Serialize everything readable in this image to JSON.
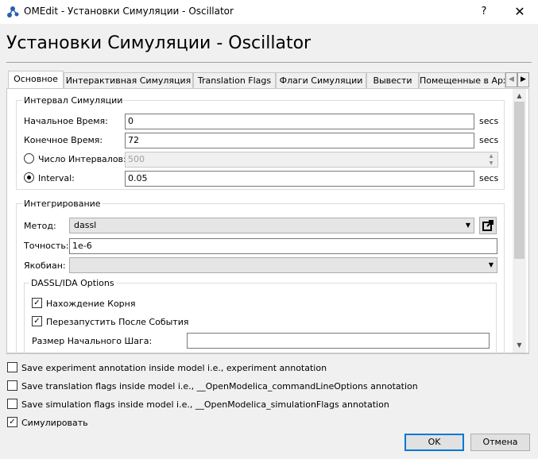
{
  "window": {
    "title": "OMEdit - Установки Симуляции - Oscillator",
    "help_label": "?",
    "close_label": "✕"
  },
  "heading": "Установки Симуляции - Oscillator",
  "tabs": [
    {
      "label": "Основное",
      "active": true
    },
    {
      "label": "Интерактивная Симуляция",
      "active": false
    },
    {
      "label": "Translation Flags",
      "active": false
    },
    {
      "label": "Флаги Симуляции",
      "active": false
    },
    {
      "label": "Вывести",
      "active": false
    },
    {
      "label": "Помещенные в Арх",
      "active": false
    }
  ],
  "interval": {
    "title": "Интервал Симуляции",
    "start_label": "Начальное Время:",
    "start_value": "0",
    "start_unit": "secs",
    "stop_label": "Конечное Время:",
    "stop_value": "72",
    "stop_unit": "secs",
    "intervals_label": "Число Интервалов:",
    "intervals_value": "500",
    "intervals_selected": false,
    "interval_label": "Interval:",
    "interval_value": "0.05",
    "interval_unit": "secs",
    "interval_selected": true
  },
  "integration": {
    "title": "Интегрирование",
    "method_label": "Метод:",
    "method_value": "dassl",
    "tolerance_label": "Точность:",
    "tolerance_value": "1e-6",
    "jacobian_label": "Якобиан:",
    "jacobian_value": "",
    "dassl": {
      "title": "DASSL/IDA Options",
      "root_finding_label": "Нахождение Корня",
      "root_finding_checked": true,
      "restart_label": "Перезапустить После События",
      "restart_checked": true,
      "initial_step_label": "Размер Начального Шага:",
      "initial_step_value": ""
    }
  },
  "options": {
    "save_experiment_label": "Save experiment annotation inside model i.e., experiment annotation",
    "save_experiment_checked": false,
    "save_translation_label": "Save translation flags inside model i.e., __OpenModelica_commandLineOptions annotation",
    "save_translation_checked": false,
    "save_simulation_label": "Save simulation flags inside model i.e., __OpenModelica_simulationFlags annotation",
    "save_simulation_checked": false,
    "simulate_label": "Симулировать",
    "simulate_checked": true
  },
  "buttons": {
    "ok": "OK",
    "cancel": "Отмена"
  },
  "icons": {
    "app": "omedit-app-icon",
    "method_setup": "open-external-icon"
  }
}
